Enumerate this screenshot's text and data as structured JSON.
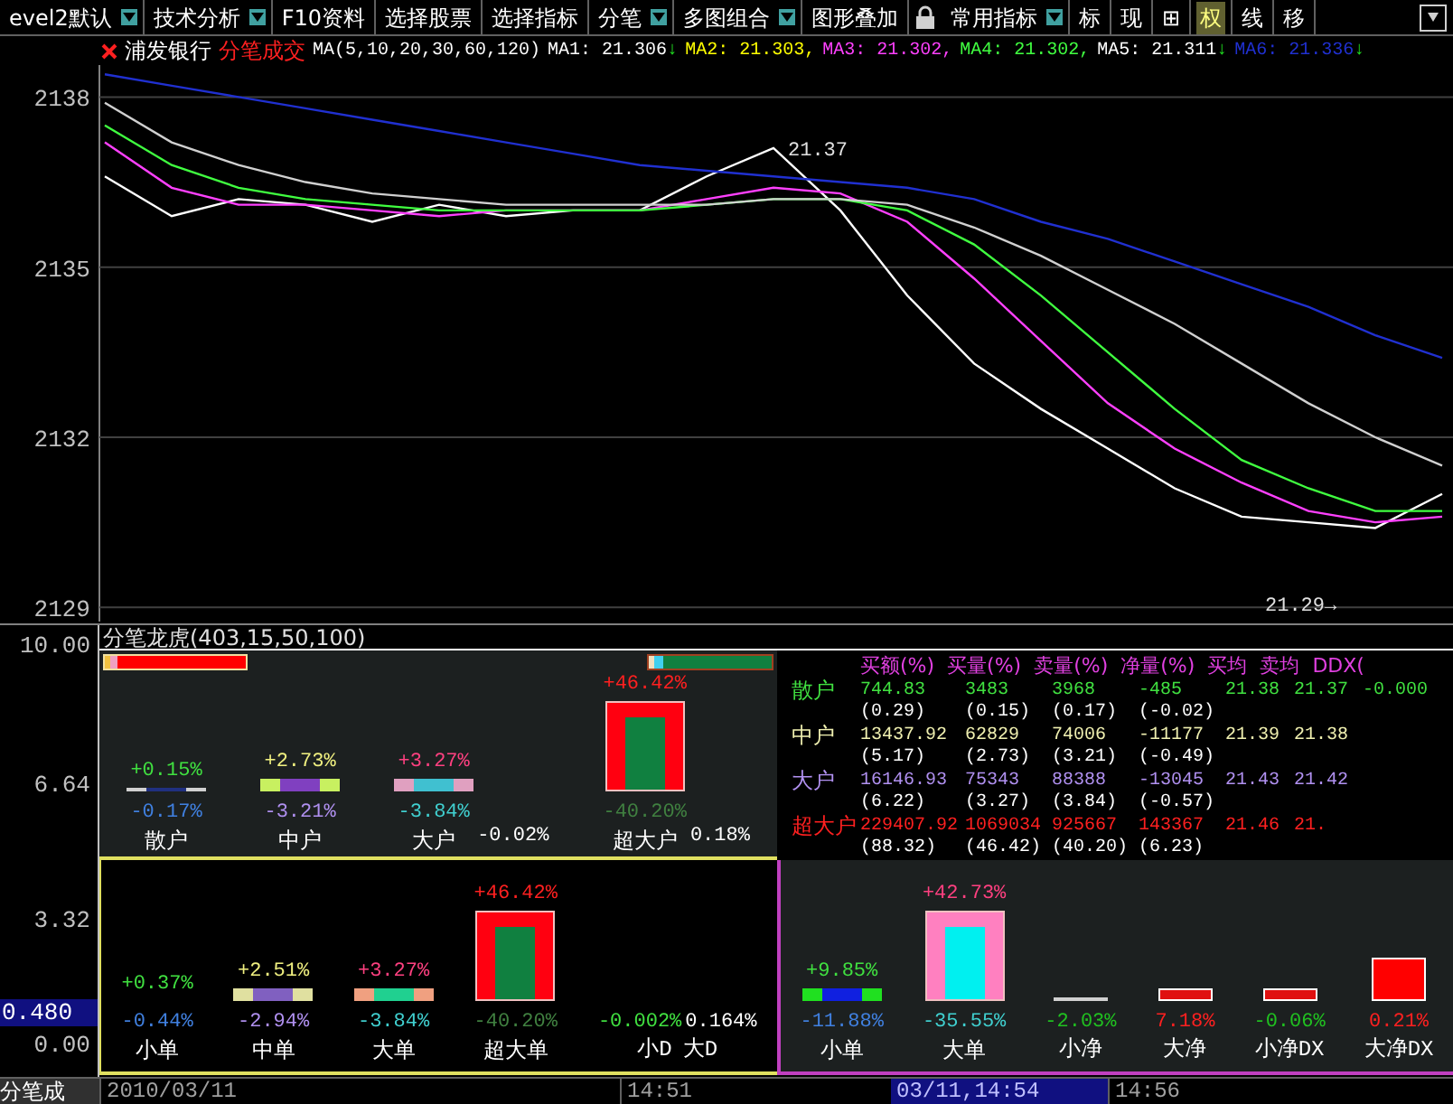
{
  "toolbar": [
    {
      "label": "evel2默认",
      "dropdown": true,
      "selected": false
    },
    {
      "label": "技术分析",
      "dropdown": true,
      "selected": false
    },
    {
      "label": "F10资料",
      "dropdown": false,
      "selected": false
    },
    {
      "label": "选择股票",
      "dropdown": false,
      "selected": false
    },
    {
      "label": "选择指标",
      "dropdown": false,
      "selected": false
    },
    {
      "label": "分笔",
      "dropdown": true,
      "selected": false
    },
    {
      "label": "多图组合",
      "dropdown": true,
      "selected": false
    },
    {
      "label": "图形叠加",
      "dropdown": false,
      "selected": false
    },
    {
      "label": "常用指标",
      "dropdown": true,
      "selected": false
    },
    {
      "label": "标",
      "dropdown": false,
      "selected": false
    },
    {
      "label": "现",
      "dropdown": false,
      "selected": false
    },
    {
      "label": "⊞",
      "dropdown": false,
      "selected": false
    },
    {
      "label": "权",
      "dropdown": false,
      "selected": true
    },
    {
      "label": "线",
      "dropdown": false,
      "selected": false
    },
    {
      "label": "移",
      "dropdown": false,
      "selected": false
    }
  ],
  "price_chart": {
    "stock": "浦发银行",
    "mode": "分笔成交",
    "ma_params": "MA(5,10,20,30,60,120)",
    "ma_readings": [
      {
        "text": "MA1: 21.306",
        "arrow": "↓",
        "color": "#ffffff"
      },
      {
        "text": "MA2: 21.303,",
        "color": "#ffff00"
      },
      {
        "text": "MA3: 21.302,",
        "color": "#ff40ff"
      },
      {
        "text": "MA4: 21.302,",
        "color": "#40ff40"
      },
      {
        "text": "MA5: 21.311",
        "arrow": "↓",
        "color": "#ffffff"
      },
      {
        "text": "MA6: 21.336",
        "arrow": "↓",
        "color": "#2030d0"
      }
    ],
    "chart_data": {
      "type": "line",
      "grid": true,
      "ylim": [
        2128.75,
        2138.5
      ],
      "yticks": [
        2138,
        2135,
        2132,
        2129
      ],
      "series": [
        {
          "color": "#ffffff",
          "values": [
            2136.6,
            2135.9,
            2136.2,
            2136.1,
            2135.8,
            2136.1,
            2135.9,
            2136.0,
            2136.0,
            2136.6,
            2137.1,
            2136.0,
            2134.5,
            2133.3,
            2132.5,
            2131.8,
            2131.1,
            2130.6,
            2130.5,
            2130.4,
            2131.0
          ]
        },
        {
          "color": "#ff40ff",
          "values": [
            2137.2,
            2136.4,
            2136.1,
            2136.1,
            2136.0,
            2135.9,
            2136.0,
            2136.0,
            2136.0,
            2136.2,
            2136.4,
            2136.3,
            2135.8,
            2134.8,
            2133.7,
            2132.6,
            2131.8,
            2131.2,
            2130.7,
            2130.5,
            2130.6
          ]
        },
        {
          "color": "#40ff40",
          "values": [
            2137.5,
            2136.8,
            2136.4,
            2136.2,
            2136.1,
            2136.0,
            2136.0,
            2136.0,
            2136.0,
            2136.1,
            2136.2,
            2136.2,
            2136.0,
            2135.4,
            2134.5,
            2133.5,
            2132.5,
            2131.6,
            2131.1,
            2130.7,
            2130.7
          ]
        },
        {
          "color": "#d0d0d0",
          "values": [
            2137.9,
            2137.2,
            2136.8,
            2136.5,
            2136.3,
            2136.2,
            2136.1,
            2136.1,
            2136.1,
            2136.1,
            2136.2,
            2136.2,
            2136.1,
            2135.7,
            2135.2,
            2134.6,
            2134.0,
            2133.3,
            2132.6,
            2132.0,
            2131.5
          ]
        },
        {
          "color": "#2030d0",
          "values": [
            2138.4,
            2138.2,
            2138.0,
            2137.8,
            2137.6,
            2137.4,
            2137.2,
            2137.0,
            2136.8,
            2136.7,
            2136.6,
            2136.5,
            2136.4,
            2136.2,
            2135.8,
            2135.5,
            2135.1,
            2134.7,
            2134.3,
            2133.8,
            2133.4
          ]
        }
      ],
      "annotations": [
        "21.37",
        "21.29→"
      ]
    }
  },
  "indicator": {
    "title": "分笔龙虎(403,15,50,100)",
    "axis_labels": [
      {
        "text": "10.00",
        "selected": false
      },
      {
        "text": "6.64",
        "selected": false
      },
      {
        "text": "3.32",
        "selected": false
      },
      {
        "text": "0.480",
        "selected": true
      },
      {
        "text": "0.00",
        "selected": false
      }
    ],
    "trader_groups": [
      {
        "label": "散户",
        "up": "+0.15%",
        "down": "-0.17%",
        "kind": "line",
        "color": "#d0d0d0",
        "inner": {
          "color": "#203080"
        }
      },
      {
        "label": "中户",
        "up": "+2.73%",
        "down": "-3.21%",
        "kind": "flat",
        "color": "#c8f060",
        "inner": {
          "color": "#8040c0"
        }
      },
      {
        "label": "大户",
        "up": "+3.27%",
        "down": "-3.84%",
        "kind": "flat",
        "color": "#e0a0c0",
        "inner": {
          "color": "#40c0d0"
        },
        "extra": "-0.02%"
      },
      {
        "label": "超大户",
        "up": "+46.42%",
        "down": "-40.20%",
        "kind": "tall",
        "color": "#ff0010",
        "inner": {
          "color": "#108040"
        },
        "extra": "0.18%"
      }
    ],
    "table": {
      "columns": [
        "买额(%)",
        "买量(%)",
        "卖量(%)",
        "净量(%)",
        "买均",
        "卖均",
        "DDX("
      ],
      "rows": [
        {
          "label": "散户",
          "color": "#40e040",
          "values": [
            "744.83",
            "3483",
            "3968",
            "-485",
            "21.38",
            "21.37",
            "-0.000"
          ],
          "shares": [
            "(0.29)",
            "(0.15)",
            "(0.17)",
            "(-0.02)"
          ]
        },
        {
          "label": "中户",
          "color": "#f0f0b0",
          "values": [
            "13437.92",
            "62829",
            "74006",
            "-11177",
            "21.39",
            "21.38"
          ],
          "shares": [
            "(5.17)",
            "(2.73)",
            "(3.21)",
            "(-0.49)"
          ]
        },
        {
          "label": "大户",
          "color": "#b090f0",
          "values": [
            "16146.93",
            "75343",
            "88388",
            "-13045",
            "21.43",
            "21.42"
          ],
          "shares": [
            "(6.22)",
            "(3.27)",
            "(3.84)",
            "(-0.57)"
          ]
        },
        {
          "label": "超大户",
          "color": "#ff2020",
          "values": [
            "229407.92",
            "1069034",
            "925667",
            "143367",
            "21.46",
            "21."
          ],
          "shares": [
            "(88.32)",
            "(46.42)",
            "(40.20)",
            "(6.23)"
          ]
        }
      ]
    },
    "order_groups": [
      {
        "label": "小单",
        "up": "+0.37%",
        "down": "-0.44%",
        "kind": "none"
      },
      {
        "label": "中单",
        "up": "+2.51%",
        "down": "-2.94%",
        "kind": "flat",
        "color": "#e0e0a0",
        "inner": {
          "color": "#8060c0"
        }
      },
      {
        "label": "大单",
        "up": "+3.27%",
        "down": "-3.84%",
        "kind": "flat",
        "color": "#f0a080",
        "inner": {
          "color": "#20d090"
        }
      },
      {
        "label": "超大单",
        "up": "+46.42%",
        "down": "-40.20%",
        "kind": "tall",
        "color": "#ff0010",
        "inner": {
          "color": "#108040"
        }
      }
    ],
    "order_extra": {
      "labels": [
        "小D",
        "大D"
      ],
      "values": [
        "-0.002%",
        "0.164%"
      ]
    },
    "compare_groups": [
      {
        "label": "小单",
        "up": "+9.85%",
        "down": "-11.88%",
        "kind": "flat",
        "color": "#20e020",
        "inner": {
          "color": "#1020e0"
        }
      },
      {
        "label": "大单",
        "up": "+42.73%",
        "down": "-35.55%",
        "kind": "tall",
        "color": "#ff80c0",
        "inner": {
          "color": "#00f0f0"
        }
      }
    ],
    "net_items": [
      {
        "label": "小净",
        "value": "-2.03%",
        "kind": "line",
        "color": "#20c020"
      },
      {
        "label": "大净",
        "value": "7.18%",
        "kind": "small",
        "color": "#ff2020"
      },
      {
        "label": "小净DX",
        "value": "-0.06%",
        "kind": "small",
        "color": "#20c020"
      },
      {
        "label": "大净DX",
        "value": "0.21%",
        "kind": "big",
        "color": "#ff2020"
      }
    ]
  },
  "status_bar": {
    "title": "分笔成",
    "times": [
      {
        "text": "2010/03/11",
        "selected": false
      },
      {
        "text": "14:51",
        "selected": false
      },
      {
        "text": "03/11,14:54",
        "selected": true
      },
      {
        "text": "14:56",
        "selected": false
      }
    ]
  }
}
